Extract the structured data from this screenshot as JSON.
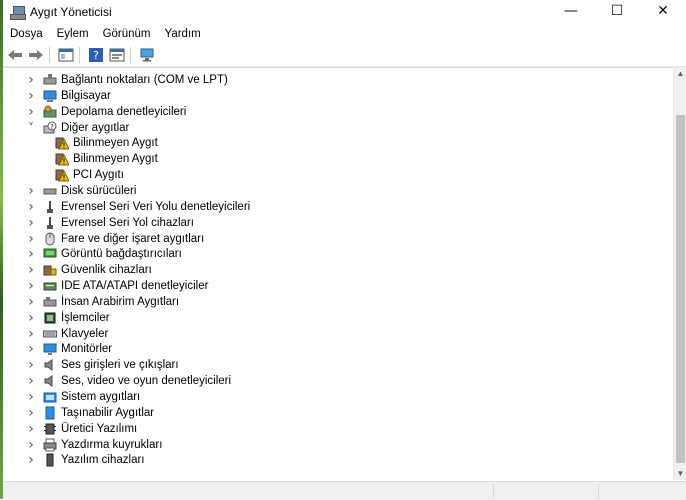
{
  "window": {
    "title": "Aygıt Yöneticisi"
  },
  "menu": [
    "Dosya",
    "Eylem",
    "Görünüm",
    "Yardım"
  ],
  "toolbar": [
    "back-icon",
    "forward-icon",
    "view-icon",
    "help-icon",
    "properties-icon",
    "scan-monitor-icon"
  ],
  "tree": [
    {
      "label": "Bağlantı noktaları (COM ve LPT)",
      "level": 0,
      "expanded": false,
      "icon": "port-icon"
    },
    {
      "label": "Bilgisayar",
      "level": 0,
      "expanded": false,
      "icon": "computer-icon"
    },
    {
      "label": "Depolama denetleyicileri",
      "level": 0,
      "expanded": false,
      "icon": "storage-icon"
    },
    {
      "label": "Diğer aygıtlar",
      "level": 0,
      "expanded": true,
      "icon": "other-devices-icon"
    },
    {
      "label": "Bilinmeyen Aygıt",
      "level": 1,
      "icon": "warning-device-icon"
    },
    {
      "label": "Bilinmeyen Aygıt",
      "level": 1,
      "icon": "warning-device-icon"
    },
    {
      "label": "PCI Aygıtı",
      "level": 1,
      "icon": "warning-device-icon"
    },
    {
      "label": "Disk sürücüleri",
      "level": 0,
      "expanded": false,
      "icon": "disk-icon"
    },
    {
      "label": "Evrensel Seri Veri Yolu denetleyicileri",
      "level": 0,
      "expanded": false,
      "icon": "usb-icon"
    },
    {
      "label": "Evrensel Seri Yol cihazları",
      "level": 0,
      "expanded": false,
      "icon": "usb-icon"
    },
    {
      "label": "Fare ve diğer işaret aygıtları",
      "level": 0,
      "expanded": false,
      "icon": "mouse-icon"
    },
    {
      "label": "Görüntü bağdaştırıcıları",
      "level": 0,
      "expanded": false,
      "icon": "display-adapter-icon"
    },
    {
      "label": "Güvenlik cihazları",
      "level": 0,
      "expanded": false,
      "icon": "security-icon"
    },
    {
      "label": "IDE ATA/ATAPI denetleyiciler",
      "level": 0,
      "expanded": false,
      "icon": "ide-icon"
    },
    {
      "label": "İnsan Arabirim Aygıtları",
      "level": 0,
      "expanded": false,
      "icon": "hid-icon"
    },
    {
      "label": "İşlemciler",
      "level": 0,
      "expanded": false,
      "icon": "processor-icon"
    },
    {
      "label": "Klavyeler",
      "level": 0,
      "expanded": false,
      "icon": "keyboard-icon"
    },
    {
      "label": "Monitörler",
      "level": 0,
      "expanded": false,
      "icon": "monitor-icon"
    },
    {
      "label": "Ses girişleri ve çıkışları",
      "level": 0,
      "expanded": false,
      "icon": "audio-icon"
    },
    {
      "label": "Ses, video ve oyun denetleyicileri",
      "level": 0,
      "expanded": false,
      "icon": "audio-icon"
    },
    {
      "label": "Sistem aygıtları",
      "level": 0,
      "expanded": false,
      "icon": "system-icon"
    },
    {
      "label": "Taşınabilir Aygıtlar",
      "level": 0,
      "expanded": false,
      "icon": "portable-icon"
    },
    {
      "label": "Üretici Yazılımı",
      "level": 0,
      "expanded": false,
      "icon": "firmware-icon"
    },
    {
      "label": "Yazdırma kuyrukları",
      "level": 0,
      "expanded": false,
      "icon": "printer-icon"
    },
    {
      "label": "Yazılım cihazları",
      "level": 0,
      "expanded": false,
      "icon": "software-device-icon"
    }
  ],
  "colors": {
    "accent": "#1e6fc2",
    "warning": "#f2c200",
    "background": "#ffffff"
  }
}
